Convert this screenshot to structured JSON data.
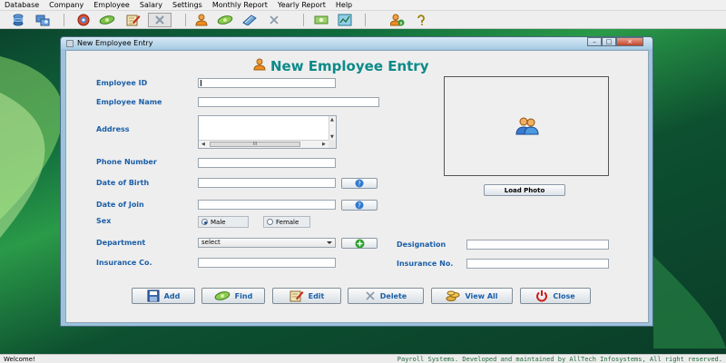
{
  "menu": [
    "Database",
    "Company",
    "Employee",
    "Salary",
    "Settings",
    "Monthly Report",
    "Yearly Report",
    "Help"
  ],
  "window": {
    "title": "New Employee Entry",
    "heading": "New Employee Entry"
  },
  "form": {
    "employee_id_label": "Employee ID",
    "employee_name_label": "Employee Name",
    "address_label": "Address",
    "phone_label": "Phone Number",
    "dob_label": "Date of Birth",
    "doj_label": "Date of Join",
    "sex_label": "Sex",
    "sex_male": "Male",
    "sex_female": "Female",
    "department_label": "Department",
    "department_value": "select",
    "designation_label": "Designation",
    "insurance_co_label": "Insurance Co.",
    "insurance_no_label": "Insurance No.",
    "scroll_thumb": "III"
  },
  "photo": {
    "load_label": "Load Photo"
  },
  "actions": {
    "add": "Add",
    "find": "Find",
    "edit": "Edit",
    "delete": "Delete",
    "view_all": "View All",
    "close": "Close"
  },
  "status": {
    "left": "Welcome!",
    "right": "Payroll Systems. Developed and maintained by AllTech Infosystems, All right reserved."
  },
  "icons": {
    "toolbar": [
      "database-icon",
      "company-add-icon",
      "employee-record-icon",
      "money-icon",
      "edit-icon",
      "delete-icon",
      "users-icon",
      "find-money-icon",
      "list-icon",
      "delete-x-icon",
      "salary-money-icon",
      "report-icon",
      "info-user-icon",
      "help-icon"
    ]
  },
  "colors": {
    "label_blue": "#1b5fa8",
    "heading_teal": "#0c8a88",
    "desktop_green": "#0f6b3c"
  }
}
